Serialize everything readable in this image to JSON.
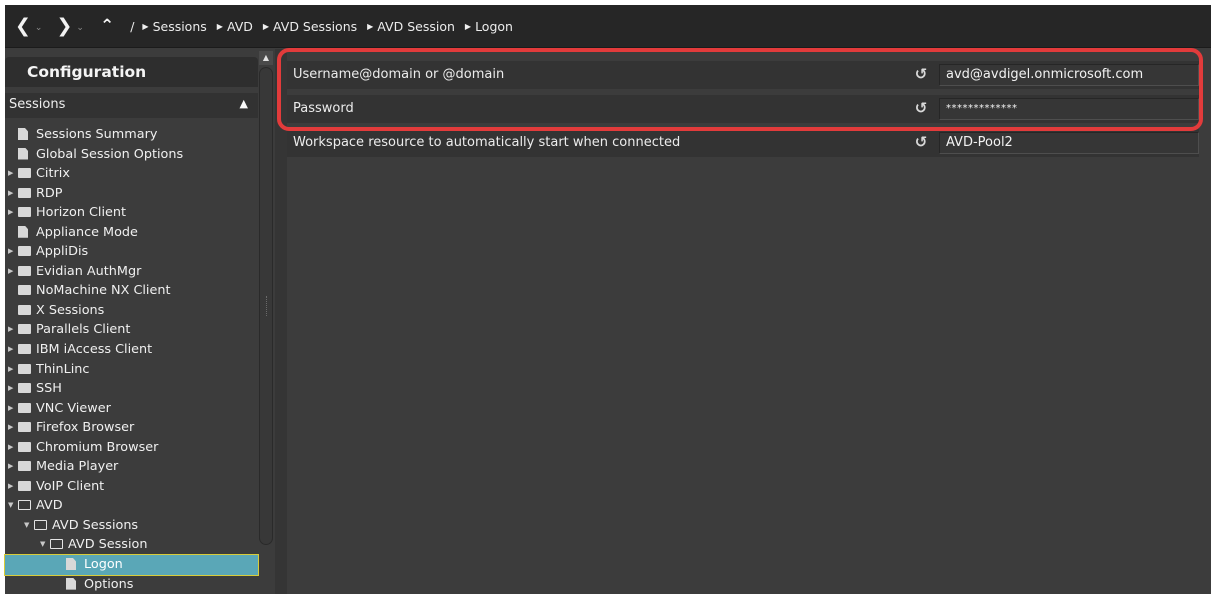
{
  "nav": {
    "back_icon": "back-arrow-icon",
    "forward_icon": "forward-arrow-icon",
    "up_icon": "up-arrow-icon",
    "root_separator": "/",
    "breadcrumbs": [
      "Sessions",
      "AVD",
      "AVD Sessions",
      "AVD Session",
      "Logon"
    ]
  },
  "sidebar": {
    "title": "Configuration",
    "section": "Sessions",
    "items": [
      {
        "label": "Sessions Summary",
        "type": "doc",
        "level": 0,
        "expandable": false
      },
      {
        "label": "Global Session Options",
        "type": "doc",
        "level": 0,
        "expandable": false
      },
      {
        "label": "Citrix",
        "type": "folder",
        "level": 0,
        "expandable": true
      },
      {
        "label": "RDP",
        "type": "folder",
        "level": 0,
        "expandable": true
      },
      {
        "label": "Horizon Client",
        "type": "folder",
        "level": 0,
        "expandable": true
      },
      {
        "label": "Appliance Mode",
        "type": "doc",
        "level": 0,
        "expandable": false
      },
      {
        "label": "AppliDis",
        "type": "folder",
        "level": 0,
        "expandable": true
      },
      {
        "label": "Evidian AuthMgr",
        "type": "folder",
        "level": 0,
        "expandable": true
      },
      {
        "label": "NoMachine NX Client",
        "type": "folder",
        "level": 0,
        "expandable": false
      },
      {
        "label": "X Sessions",
        "type": "folder",
        "level": 0,
        "expandable": false
      },
      {
        "label": "Parallels Client",
        "type": "folder",
        "level": 0,
        "expandable": true
      },
      {
        "label": "IBM iAccess Client",
        "type": "folder",
        "level": 0,
        "expandable": true
      },
      {
        "label": "ThinLinc",
        "type": "folder",
        "level": 0,
        "expandable": true
      },
      {
        "label": "SSH",
        "type": "folder",
        "level": 0,
        "expandable": true
      },
      {
        "label": "VNC Viewer",
        "type": "folder",
        "level": 0,
        "expandable": true
      },
      {
        "label": "Firefox Browser",
        "type": "folder",
        "level": 0,
        "expandable": true
      },
      {
        "label": "Chromium Browser",
        "type": "folder",
        "level": 0,
        "expandable": true
      },
      {
        "label": "Media Player",
        "type": "folder",
        "level": 0,
        "expandable": true
      },
      {
        "label": "VoIP Client",
        "type": "folder",
        "level": 0,
        "expandable": true
      },
      {
        "label": "AVD",
        "type": "folder-open",
        "level": 0,
        "expandable": true,
        "expanded": true
      },
      {
        "label": "AVD Sessions",
        "type": "folder-open",
        "level": 1,
        "expandable": true,
        "expanded": true
      },
      {
        "label": "AVD Session",
        "type": "folder-open",
        "level": 2,
        "expandable": true,
        "expanded": true
      },
      {
        "label": "Logon",
        "type": "doc",
        "level": 3,
        "expandable": false,
        "selected": true
      },
      {
        "label": "Options",
        "type": "doc",
        "level": 3,
        "expandable": false
      }
    ]
  },
  "settings": [
    {
      "label": "Username@domain or @domain",
      "value": "avd@avdigel.onmicrosoft.com",
      "kind": "text"
    },
    {
      "label": "Password",
      "value": "*************",
      "kind": "password"
    },
    {
      "label": "Workspace resource to automatically start when connected",
      "value": "AVD-Pool2",
      "kind": "text"
    }
  ],
  "colors": {
    "highlight": "#e23b3b",
    "selected": "#5aa7b7",
    "selected_outline": "#d8cc3a"
  }
}
